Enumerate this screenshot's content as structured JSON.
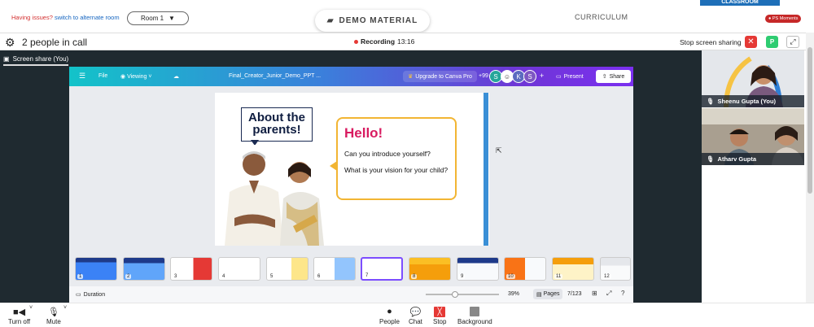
{
  "top": {
    "issues_text": "Having issues?",
    "alt_room_link": "switch to alternate room",
    "room_label": "Room 1",
    "demo_material": "DEMO MATERIAL",
    "curriculum": "CURRICULUM",
    "classroom_tab": "CLASSROOM",
    "ps_moments": "PS Moments"
  },
  "call": {
    "people_count": "2 people in call",
    "recording_label": "Recording",
    "recording_time": "13:16",
    "stop_screen_sharing": "Stop screen sharing",
    "p_badge": "P"
  },
  "screen_tab": "Screen share (You)",
  "canva": {
    "file": "File",
    "viewing": "Viewing",
    "doc_title": "Final_Creator_Junior_Demo_PPT ...",
    "upgrade": "Upgrade to Canva Pro",
    "more_count": "+99",
    "avatars": [
      "S",
      "K",
      "S"
    ],
    "present": "Present",
    "share": "Share",
    "duration": "Duration",
    "zoom": "39%",
    "pages": "Pages",
    "page_num": "7/123",
    "thumb_numbers": [
      "1",
      "2",
      "3",
      "4",
      "5",
      "6",
      "7",
      "8",
      "9",
      "10",
      "11",
      "12"
    ]
  },
  "slide": {
    "about_line1": "About the",
    "about_line2": "parents!",
    "hello": "Hello!",
    "question1": "Can you introduce yourself?",
    "question2": "What is your vision for your child?"
  },
  "participants": [
    {
      "name": "Sheenu Gupta (You)"
    },
    {
      "name": "Atharv Gupta"
    }
  ],
  "controls": {
    "turn_off": "Turn off",
    "mute": "Mute",
    "people": "People",
    "chat": "Chat",
    "stop": "Stop",
    "background": "Background"
  },
  "colors": {
    "canva_gradient_start": "#13c3c9",
    "canva_gradient_end": "#7b2ff0",
    "hello_pink": "#d81b60",
    "bubble_yellow": "#f2b533",
    "stop_red": "#e53935"
  }
}
